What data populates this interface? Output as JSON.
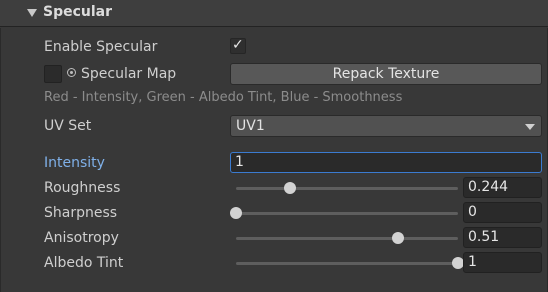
{
  "section": {
    "title": "Specular"
  },
  "rows": {
    "enable_specular": {
      "label": "Enable Specular",
      "checked": true,
      "check_glyph": "✓"
    },
    "specular_map": {
      "label": "Specular Map",
      "button_label": "Repack Texture"
    },
    "hint": "Red - Intensity, Green - Albedo Tint, Blue - Smoothness",
    "uv_set": {
      "label": "UV Set",
      "selected": "UV1"
    },
    "intensity": {
      "label": "Intensity",
      "value": "1"
    },
    "roughness": {
      "label": "Roughness",
      "value": "0.244",
      "fraction": 0.244
    },
    "sharpness": {
      "label": "Sharpness",
      "value": "0",
      "fraction": 0
    },
    "anisotropy": {
      "label": "Anisotropy",
      "value": "0.51",
      "fraction": 0.73
    },
    "albedo_tint": {
      "label": "Albedo Tint",
      "value": "1",
      "fraction": 1
    }
  },
  "colors": {
    "focus_accent": "#3b7bd0",
    "active_label": "#7fb0e8"
  },
  "icons": {
    "foldout": "triangle-down-icon",
    "object_picker": "object-picker-icon",
    "dropdown": "caret-down-icon"
  }
}
